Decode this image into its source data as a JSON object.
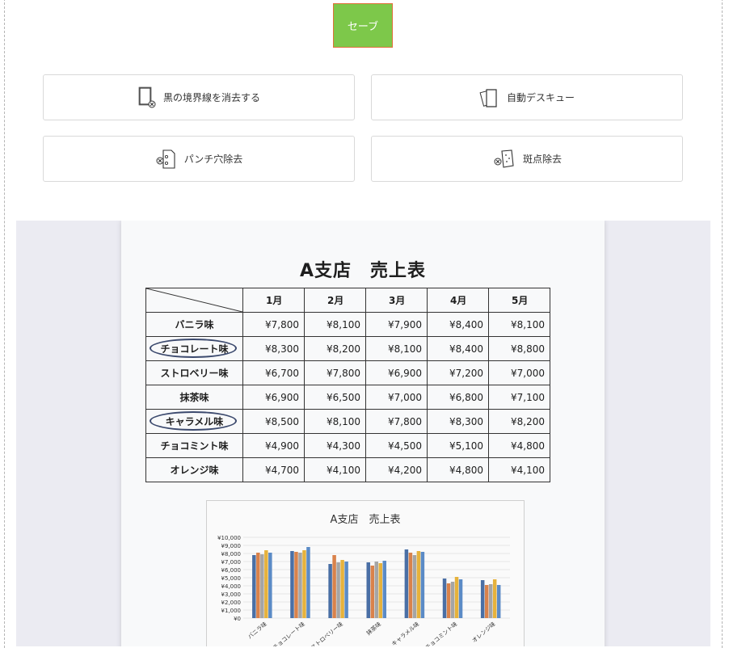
{
  "toolbar": {
    "save_label": "セーブ"
  },
  "options": {
    "remove_black_border": "黒の境界線を消去する",
    "auto_deskew": "自動デスキュー",
    "punch_hole_removal": "パンチ穴除去",
    "spot_removal": "斑点除去"
  },
  "document": {
    "title": "A支店　売上表",
    "months": [
      "1月",
      "2月",
      "3月",
      "4月",
      "5月"
    ],
    "rows": [
      {
        "flavor": "バニラ味",
        "circled": false,
        "values": [
          "¥7,800",
          "¥8,100",
          "¥7,900",
          "¥8,400",
          "¥8,100"
        ]
      },
      {
        "flavor": "チョコレート味",
        "circled": true,
        "values": [
          "¥8,300",
          "¥8,200",
          "¥8,100",
          "¥8,400",
          "¥8,800"
        ]
      },
      {
        "flavor": "ストロベリー味",
        "circled": false,
        "values": [
          "¥6,700",
          "¥7,800",
          "¥6,900",
          "¥7,200",
          "¥7,000"
        ]
      },
      {
        "flavor": "抹茶味",
        "circled": false,
        "values": [
          "¥6,900",
          "¥6,500",
          "¥7,000",
          "¥6,800",
          "¥7,100"
        ]
      },
      {
        "flavor": "キャラメル味",
        "circled": true,
        "values": [
          "¥8,500",
          "¥8,100",
          "¥7,800",
          "¥8,300",
          "¥8,200"
        ]
      },
      {
        "flavor": "チョコミント味",
        "circled": false,
        "values": [
          "¥4,900",
          "¥4,300",
          "¥4,500",
          "¥5,100",
          "¥4,800"
        ]
      },
      {
        "flavor": "オレンジ味",
        "circled": false,
        "values": [
          "¥4,700",
          "¥4,100",
          "¥4,200",
          "¥4,800",
          "¥4,100"
        ]
      }
    ]
  },
  "chart_data": {
    "type": "bar",
    "title": "A支店　売上表",
    "categories": [
      "バニラ味",
      "チョコレート味",
      "ストロベリー味",
      "抹茶味",
      "キャラメル味",
      "チョコミント味",
      "オレンジ味"
    ],
    "yticks": [
      "¥10,000",
      "¥9,000",
      "¥8,000",
      "¥7,000",
      "¥6,000",
      "¥5,000",
      "¥4,000",
      "¥3,000",
      "¥2,000",
      "¥1,000",
      "¥0"
    ],
    "ylim": [
      0,
      10000
    ],
    "series": [
      {
        "values": [
          7800,
          8300,
          6700,
          6900,
          8500,
          4900,
          4700
        ]
      },
      {
        "values": [
          8100,
          8200,
          7800,
          6500,
          8100,
          4300,
          4100
        ]
      },
      {
        "values": [
          7900,
          8100,
          6900,
          7000,
          7800,
          4500,
          4200
        ]
      },
      {
        "values": [
          8400,
          8400,
          7200,
          6800,
          8300,
          5100,
          4800
        ]
      },
      {
        "values": [
          8100,
          8800,
          7000,
          7100,
          8200,
          4800,
          4100
        ]
      }
    ],
    "colors": [
      "#4a6fa5",
      "#d9824b",
      "#a5a5a5",
      "#e6b23c",
      "#5b8bc6"
    ]
  }
}
